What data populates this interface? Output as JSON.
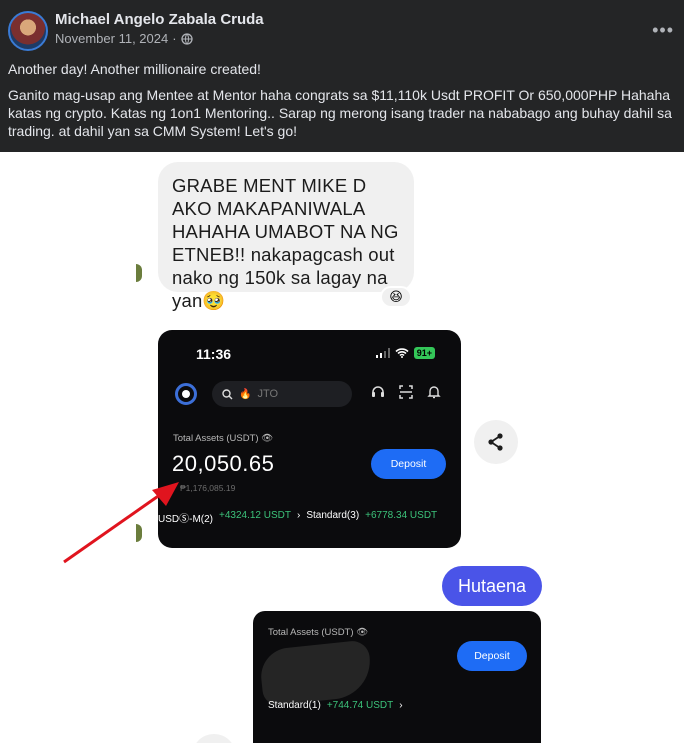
{
  "post": {
    "author": "Michael Angelo Zabala Cruda",
    "date": "November 11, 2024",
    "date_separator": "·",
    "more_label": "•••",
    "line1": "Another day! Another millionaire created!",
    "line2": "Ganito mag-usap ang Mentee at Mentor haha congrats sa $11,110k Usdt PROFIT Or 650,000PHP   Hahaha katas ng crypto. Katas ng 1on1 Mentoring.. Sarap ng merong isang trader na nababago ang buhay dahil sa trading. at dahil yan sa CMM System! Let's go!"
  },
  "chat": {
    "message": "GRABE MENT MIKE D AKO MAKAPANIWALA HAHAHA UMABOT NA NG ETNEB!! nakapagcash out nako ng 150k sa lagay na yan🥹",
    "reaction": "😆",
    "reply": "Hutaena"
  },
  "phone1": {
    "time": "11:36",
    "battery": "91+",
    "search_placeholder": "JTO",
    "assets_label": "Total Assets (USDT)",
    "assets_value": "20,050.65",
    "assets_php": "₱1,176,085.19",
    "deposit_label": "Deposit",
    "row_label_1": "USDⓈ-M(2)",
    "row_value_1": "+4324.12 USDT",
    "row_label_2": "Standard(3)",
    "row_value_2": "+6778.34 USDT"
  },
  "phone2": {
    "assets_label": "Total Assets (USDT)",
    "deposit_label": "Deposit",
    "row_label": "Standard(1)",
    "row_value": "+744.74 USDT"
  },
  "colors": {
    "header_bg": "#242526",
    "bubble_bg": "#f0f0f0",
    "reply_bubble": "#4a54e8",
    "deposit_blue": "#1e6cf5",
    "profit_green": "#3cc27a",
    "arrow_red": "#e0141e"
  },
  "icons": [
    "globe-icon",
    "more-icon",
    "search-icon",
    "flame-icon",
    "headset-icon",
    "scan-icon",
    "bell-icon",
    "eye-icon",
    "share-icon",
    "wifi-icon",
    "signal-icon"
  ]
}
